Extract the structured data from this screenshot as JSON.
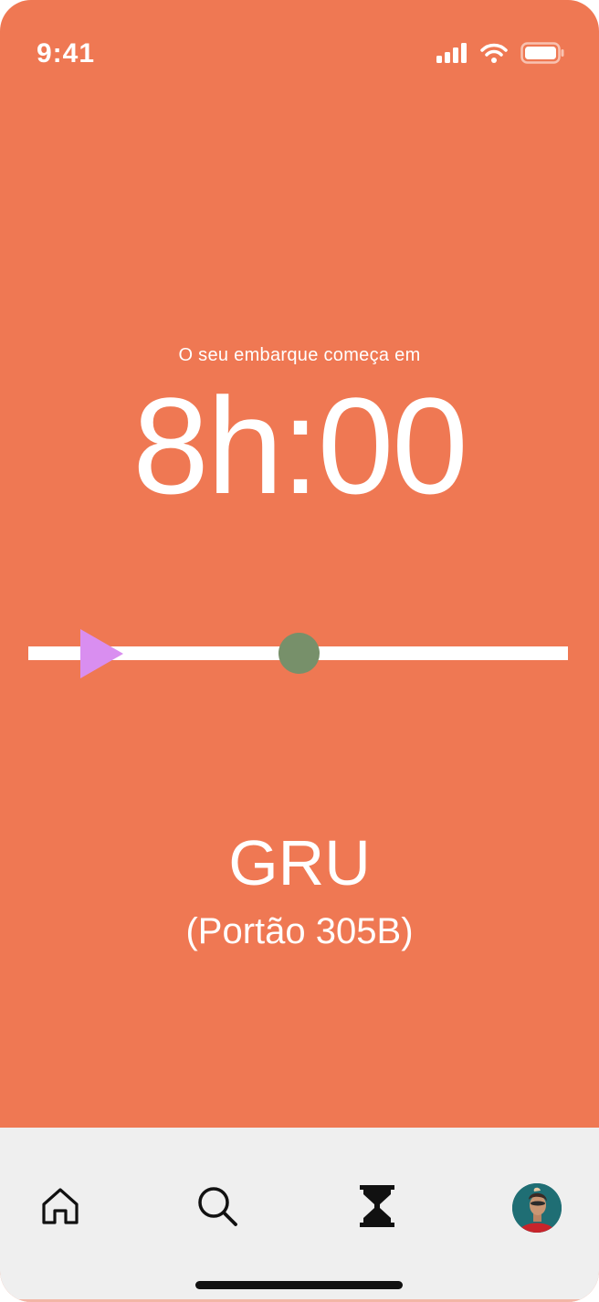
{
  "status_bar": {
    "time": "9:41",
    "icons": [
      "cellular-signal-icon",
      "wifi-icon",
      "battery-icon"
    ]
  },
  "boarding": {
    "label": "O seu embarque começa em",
    "countdown": "8h:00"
  },
  "progress": {
    "track_color": "#FFFFFF",
    "marker_icon": "play-icon",
    "marker_color": "#D98EF0",
    "knob_color": "#77906A"
  },
  "destination": {
    "airport_code": "GRU",
    "gate": "(Portão 305B)"
  },
  "tab_bar": {
    "tabs": [
      {
        "id": "home",
        "icon": "home-icon"
      },
      {
        "id": "search",
        "icon": "search-icon"
      },
      {
        "id": "timer",
        "icon": "hourglass-icon"
      },
      {
        "id": "profile",
        "icon": "avatar"
      }
    ]
  },
  "colors": {
    "background": "#EF7853",
    "tab_bar": "#EFEFEF",
    "text": "#FFFFFF"
  }
}
